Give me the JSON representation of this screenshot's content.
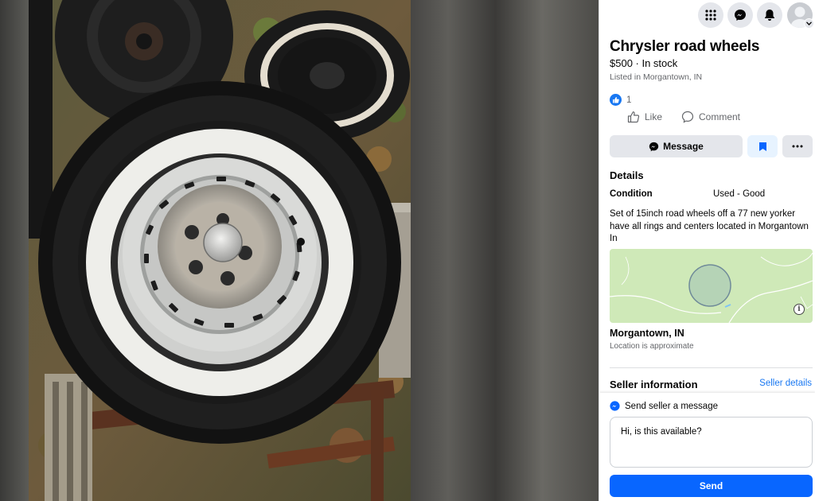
{
  "colors": {
    "accent": "#0866ff",
    "link": "#1877f2",
    "secondary_button": "#e4e6eb",
    "save_button_bg": "#e7f3ff",
    "muted_text": "#65676b",
    "map_land": "#cfe9b8"
  },
  "topbar": {
    "icons": [
      "menu-grid-icon",
      "messenger-icon",
      "notifications-bell-icon",
      "account-avatar"
    ]
  },
  "listing": {
    "title": "Chrysler road wheels",
    "price_status": "$500 · In stock",
    "listed_in": "Listed in Morgantown, IN",
    "reaction_count": "1"
  },
  "actions": {
    "like_label": "Like",
    "comment_label": "Comment",
    "message_label": "Message",
    "save_icon": "bookmark-icon",
    "more_icon": "more-horizontal-icon"
  },
  "details": {
    "heading": "Details",
    "condition_label": "Condition",
    "condition_value": "Used - Good",
    "description": "Set of 15inch road wheels off a 77 new yorker have all rings and centers located in Morgantown In"
  },
  "location": {
    "name": "Morgantown, IN",
    "note": "Location is approximate"
  },
  "seller": {
    "heading": "Seller information",
    "details_link": "Seller details"
  },
  "compose": {
    "label": "Send seller a message",
    "message_value": "Hi, is this available?",
    "send_label": "Send"
  }
}
